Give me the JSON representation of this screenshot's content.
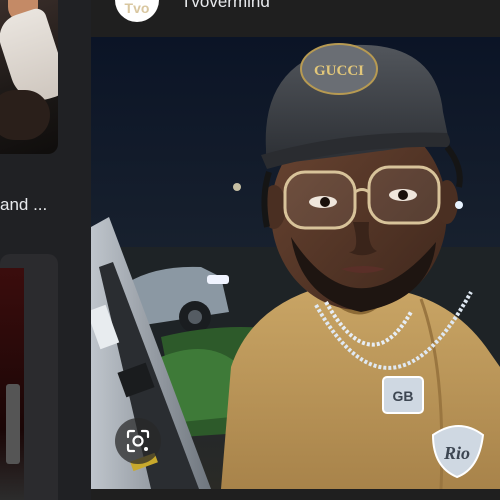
{
  "left_column": {
    "caption": "and ..."
  },
  "preview": {
    "source_logo_text": "Tvo",
    "source_name": "Tvovermind",
    "image_alt": "Man wearing a Gucci cap, glasses, tan hoodie and chains at a gas station at night",
    "cap_logo_text": "GUCCI",
    "pendant_left_text": "GB",
    "pendant_right_text": "Rio"
  },
  "actions": {
    "lens_icon": "lens-search-icon"
  }
}
